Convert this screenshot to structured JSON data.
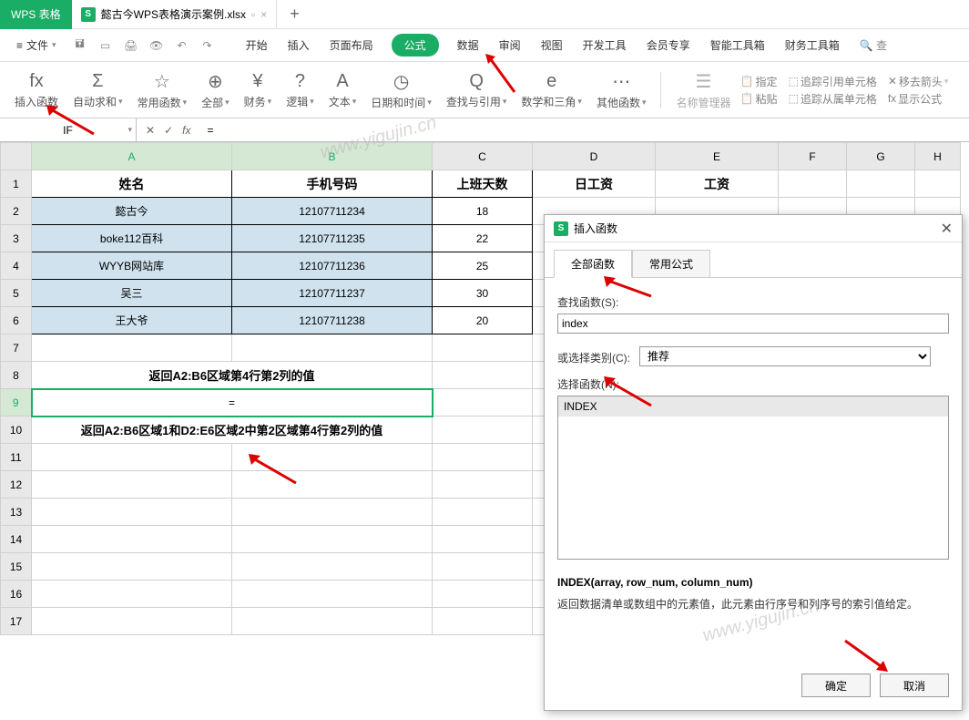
{
  "app": {
    "name": "WPS 表格"
  },
  "document": {
    "tab_name": "懿古今WPS表格演示案例.xlsx",
    "icon_letter": "S"
  },
  "menu": {
    "file": "文件",
    "tabs": [
      "开始",
      "插入",
      "页面布局",
      "公式",
      "数据",
      "审阅",
      "视图",
      "开发工具",
      "会员专享",
      "智能工具箱",
      "财务工具箱"
    ],
    "search": "查"
  },
  "ribbon": {
    "insert_fn": "插入函数",
    "auto_sum": "自动求和",
    "common_fn": "常用函数",
    "all": "全部",
    "finance": "财务",
    "logic": "逻辑",
    "text": "文本",
    "datetime": "日期和时间",
    "lookup": "查找与引用",
    "math": "数学和三角",
    "other": "其他函数",
    "name_mgr": "名称管理器",
    "define": "指定",
    "paste": "粘贴",
    "trace_prec": "追踪引用单元格",
    "trace_dep": "追踪从属单元格",
    "remove_arrows": "移去箭头",
    "show_formula": "显示公式"
  },
  "formula_bar": {
    "name_box": "IF",
    "formula": "="
  },
  "columns": [
    "A",
    "B",
    "C",
    "D",
    "E",
    "F",
    "G",
    "H"
  ],
  "headers": {
    "A": "姓名",
    "B": "手机号码",
    "C": "上班天数",
    "D": "日工资",
    "E": "工资"
  },
  "rows": [
    {
      "A": "懿古今",
      "B": "12107711234",
      "C": "18"
    },
    {
      "A": "boke112百科",
      "B": "12107711235",
      "C": "22"
    },
    {
      "A": "WYYB网站库",
      "B": "12107711236",
      "C": "25"
    },
    {
      "A": "吴三",
      "B": "12107711237",
      "C": "30"
    },
    {
      "A": "王大爷",
      "B": "12107711238",
      "C": "20"
    }
  ],
  "merged": {
    "r8": "返回A2:B6区域第4行第2列的值",
    "r9": "=",
    "r10": "返回A2:B6区域1和D2:E6区域2中第2区域第4行第2列的值"
  },
  "dialog": {
    "title": "插入函数",
    "tabs": {
      "all_fn": "全部函数",
      "common_formula": "常用公式"
    },
    "search_label": "查找函数(S):",
    "search_value": "index",
    "category_label": "或选择类别(C):",
    "category_value": "推荐",
    "select_label": "选择函数(N):",
    "list_item": "INDEX",
    "signature": "INDEX(array, row_num, column_num)",
    "description": "返回数据清单或数组中的元素值，此元素由行序号和列序号的索引值给定。",
    "ok": "确定",
    "cancel": "取消"
  },
  "watermarks": {
    "w1": "www.yigujin.cn",
    "w2": "www.yigujin.cn"
  }
}
